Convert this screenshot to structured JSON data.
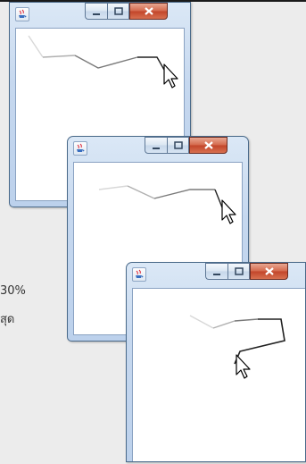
{
  "screen": {
    "partial_texts": [
      "30%",
      "สุด"
    ]
  },
  "windows": [
    {
      "id": "window-1",
      "icon": "java-cup-icon",
      "buttons": [
        "minimize-icon",
        "maximize-icon",
        "close-icon"
      ],
      "path_colors": [
        "#d8d8d8",
        "#b0b0b0",
        "#7a7a7a",
        "#202020"
      ],
      "cursor": "arrow-cursor-icon"
    },
    {
      "id": "window-2",
      "icon": "java-cup-icon",
      "buttons": [
        "minimize-icon",
        "maximize-icon",
        "close-icon"
      ],
      "path_colors": [
        "#d8d8d8",
        "#b0b0b0",
        "#7a7a7a",
        "#202020"
      ],
      "cursor": "arrow-cursor-icon"
    },
    {
      "id": "window-3",
      "icon": "java-cup-icon",
      "buttons": [
        "minimize-icon",
        "maximize-icon",
        "close-icon"
      ],
      "path_colors": [
        "#d8d8d8",
        "#b0b0b0",
        "#7a7a7a",
        "#202020"
      ],
      "cursor": "arrow-cursor-icon"
    }
  ]
}
